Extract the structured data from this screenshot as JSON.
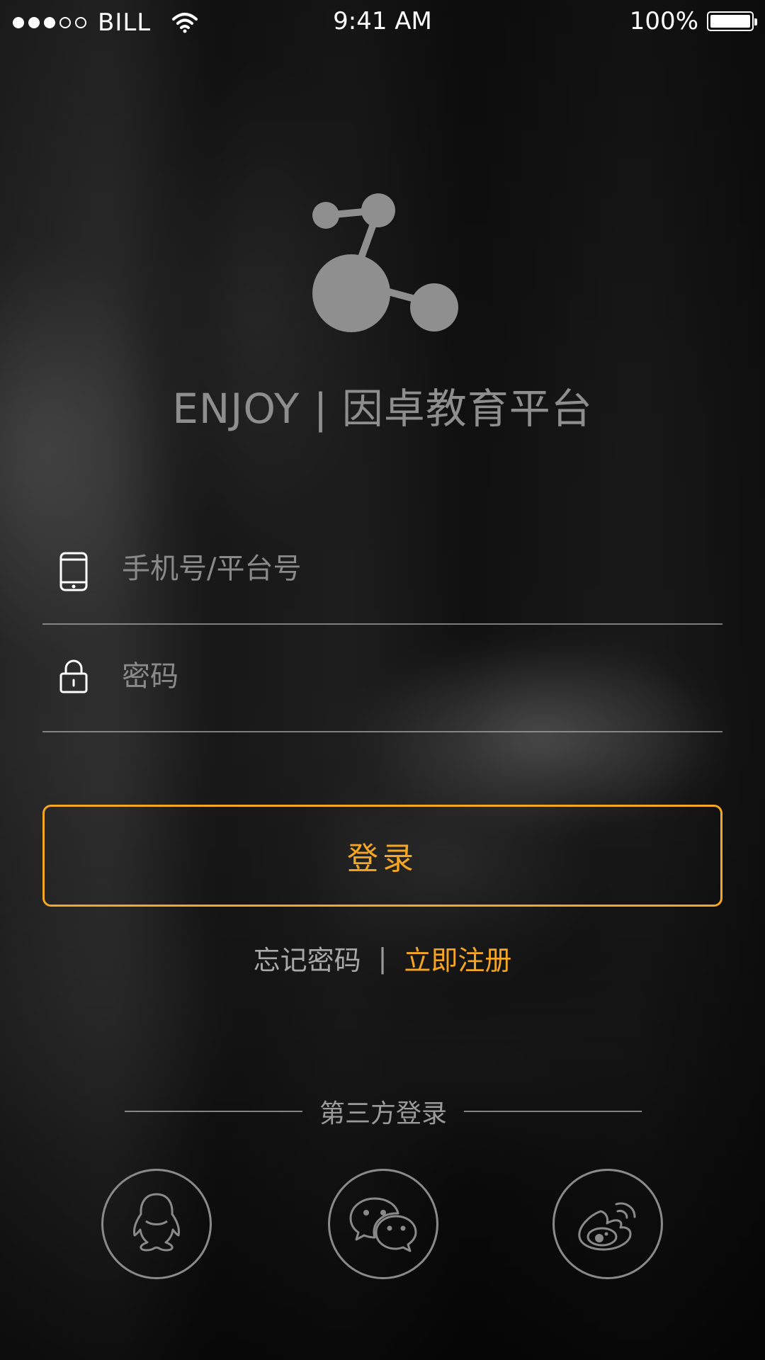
{
  "status_bar": {
    "carrier": "BILL",
    "time": "9:41 AM",
    "battery": "100%",
    "signal_dots": [
      true,
      true,
      true,
      false,
      false
    ]
  },
  "app": {
    "title": "ENJOY | 因卓教育平台",
    "logo_icon": "molecule-icon"
  },
  "form": {
    "phone_placeholder": "手机号/平台号",
    "phone_value": "",
    "password_placeholder": "密码",
    "password_value": "",
    "login_label": "登录"
  },
  "links": {
    "forgot": "忘记密码",
    "separator": "|",
    "register": "立即注册"
  },
  "third_party": {
    "label": "第三方登录",
    "providers": [
      {
        "name": "QQ",
        "icon": "qq-icon"
      },
      {
        "name": "WeChat",
        "icon": "wechat-icon"
      },
      {
        "name": "Weibo",
        "icon": "weibo-icon"
      }
    ]
  },
  "colors": {
    "accent": "#f5a623",
    "muted_text": "#8e8e8e"
  }
}
